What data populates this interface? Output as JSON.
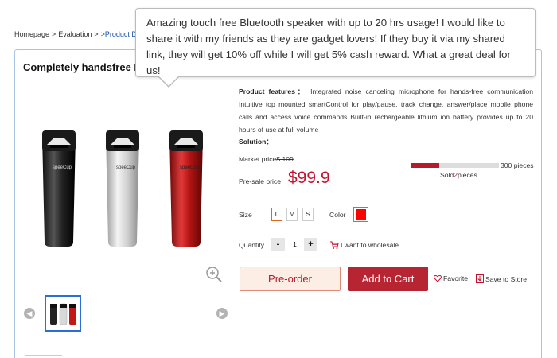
{
  "breadcrumb": {
    "home": "Homepage",
    "sep": ">",
    "evaluation": "Evaluation",
    "current": ">Product D"
  },
  "product": {
    "title": "Completely handsfree I",
    "image_alt": "speeCup speakers",
    "brand_text": "speeCup",
    "features_label": "Product features：",
    "features_text": "Integrated noise canceling microphone for hands-free communication Intuitive top mounted smartControl for play/pause, track change, answer/place mobile phone calls and access voice commands Built-in rechargeable lithium ion battery provides up to 20 hours of use at full volume",
    "solution_label": "Solution："
  },
  "tooltip": {
    "text": "Amazing touch free Bluetooth speaker with up to 20 hrs usage! I would like to share it with my friends as they are gadget lovers! If they buy it via my shared link, they will get 10% off while I will get 5% cash reward. What a great deal for us!"
  },
  "pricing": {
    "market_label": "Market price",
    "market_value": "$ 109",
    "presale_label": "Pre-sale price",
    "presale_value": "$99.9"
  },
  "sales": {
    "total_label": "300 pieces",
    "sold_prefix": "Sold",
    "sold_count": "2",
    "sold_suffix": "pieces",
    "progress_fraction": 0.32
  },
  "options": {
    "size_label": "Size",
    "sizes": [
      "L",
      "M",
      "S"
    ],
    "selected_size": "L",
    "color_label": "Color",
    "selected_color": "#ff0000"
  },
  "quantity": {
    "label": "Quantity",
    "minus": "-",
    "value": "1",
    "plus": "+",
    "wholesale": "I want to wholesale"
  },
  "actions": {
    "preorder": "Pre-order",
    "add_to_cart": "Add to Cart",
    "favorite": "Favorite",
    "save_store": "Save to Store"
  },
  "colors": {
    "accent_red": "#b82532",
    "price_red": "#c8102e",
    "border_blue": "#a9c3e6",
    "thumb_border": "#2a6fd6"
  }
}
